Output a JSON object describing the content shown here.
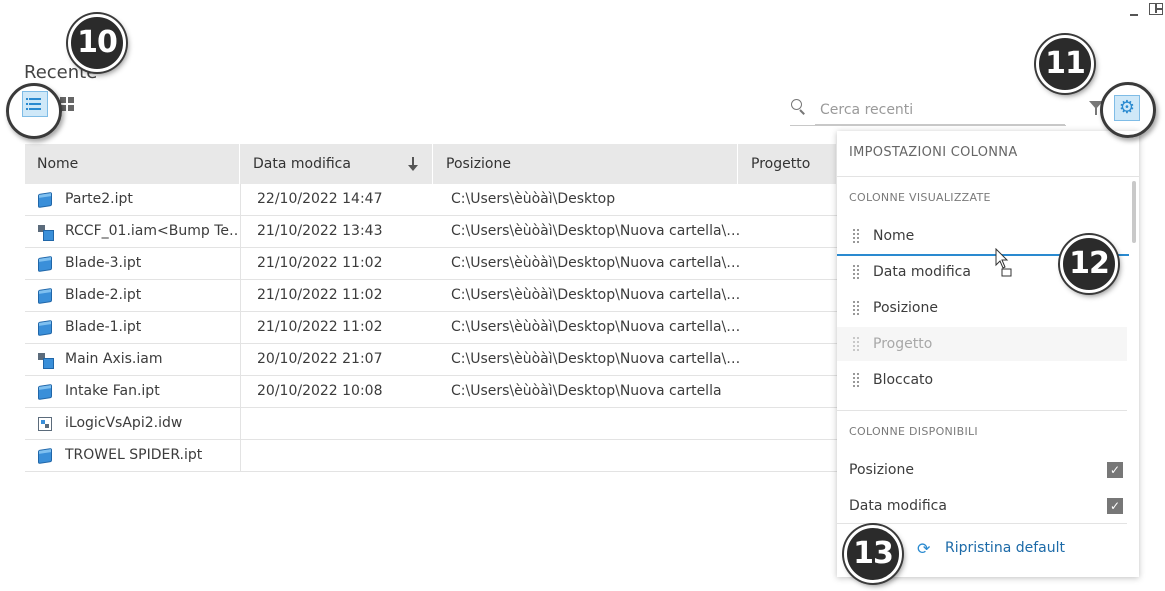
{
  "page_title": "Recente",
  "search": {
    "placeholder": "Cerca recenti"
  },
  "table": {
    "headers": [
      "Nome",
      "Data modifica",
      "Posizione",
      "Progetto"
    ],
    "rows": [
      {
        "icon": "part-icon",
        "name": "Parte2.ipt",
        "date": "22/10/2022 14:47",
        "position": "C:\\Users\\èùòàì\\Desktop"
      },
      {
        "icon": "assembly-icon",
        "name": "RCCF_01.iam<Bump Te…",
        "date": "21/10/2022 13:43",
        "position": "C:\\Users\\èùòàì\\Desktop\\Nuova cartella\\…"
      },
      {
        "icon": "part-icon",
        "name": "Blade-3.ipt",
        "date": "21/10/2022 11:02",
        "position": "C:\\Users\\èùòàì\\Desktop\\Nuova cartella\\…"
      },
      {
        "icon": "part-icon",
        "name": "Blade-2.ipt",
        "date": "21/10/2022 11:02",
        "position": "C:\\Users\\èùòàì\\Desktop\\Nuova cartella\\…"
      },
      {
        "icon": "part-icon",
        "name": "Blade-1.ipt",
        "date": "21/10/2022 11:02",
        "position": "C:\\Users\\èùòàì\\Desktop\\Nuova cartella\\…"
      },
      {
        "icon": "assembly-icon",
        "name": "Main Axis.iam",
        "date": "20/10/2022 21:07",
        "position": "C:\\Users\\èùòàì\\Desktop\\Nuova cartella\\…"
      },
      {
        "icon": "part-icon",
        "name": "Intake Fan.ipt",
        "date": "20/10/2022 10:08",
        "position": "C:\\Users\\èùòàì\\Desktop\\Nuova cartella"
      },
      {
        "icon": "drawing-icon",
        "name": "iLogicVsApi2.idw",
        "date": "",
        "position": ""
      },
      {
        "icon": "part-icon",
        "name": "TROWEL SPIDER.ipt",
        "date": "",
        "position": ""
      }
    ]
  },
  "column_settings": {
    "title": "IMPOSTAZIONI COLONNA",
    "displayed_label": "COLONNE VISUALIZZATE",
    "displayed": [
      {
        "label": "Nome",
        "disabled": false
      },
      {
        "label": "Data modifica",
        "disabled": false
      },
      {
        "label": "Posizione",
        "disabled": false
      },
      {
        "label": "Progetto",
        "disabled": true
      },
      {
        "label": "Bloccato",
        "disabled": false
      }
    ],
    "available_label": "COLONNE DISPONIBILI",
    "available": [
      {
        "label": "Posizione",
        "checked": true
      },
      {
        "label": "Data modifica",
        "checked": true
      }
    ],
    "reset_label": "Ripristina default"
  },
  "callouts": [
    "10",
    "11",
    "12",
    "13"
  ],
  "colors": {
    "accent": "#2a8ad0",
    "selected_bg": "#cfe8f8",
    "header_bg": "#e8e8e8",
    "badge": "#2b2b2b"
  }
}
